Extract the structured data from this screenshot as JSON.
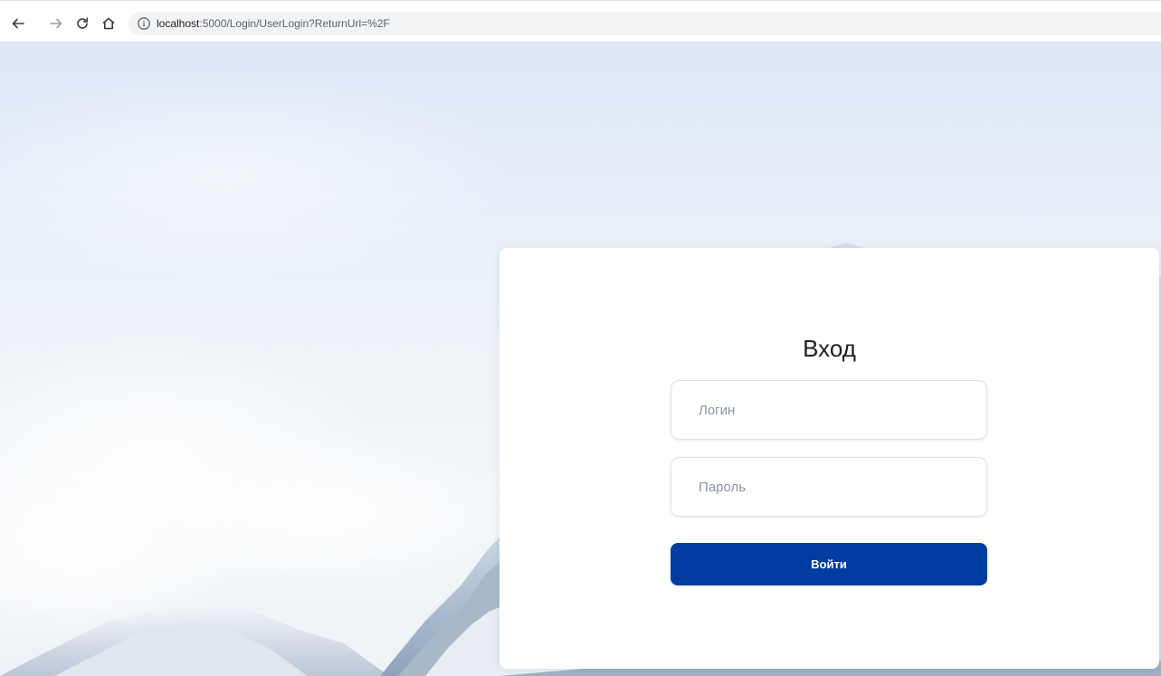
{
  "browser": {
    "url_host": "localhost",
    "url_rest": ":5000/Login/UserLogin?ReturnUrl=%2F",
    "icons": [
      "back-arrow-icon",
      "forward-arrow-icon",
      "reload-icon",
      "home-icon",
      "info-icon"
    ]
  },
  "login": {
    "title": "Вход",
    "login_placeholder": "Логин",
    "password_placeholder": "Пароль",
    "submit_label": "Войти"
  },
  "colors": {
    "primary_button": "#003da0",
    "card_background": "#ffffff",
    "placeholder_text": "#8a93a6"
  }
}
